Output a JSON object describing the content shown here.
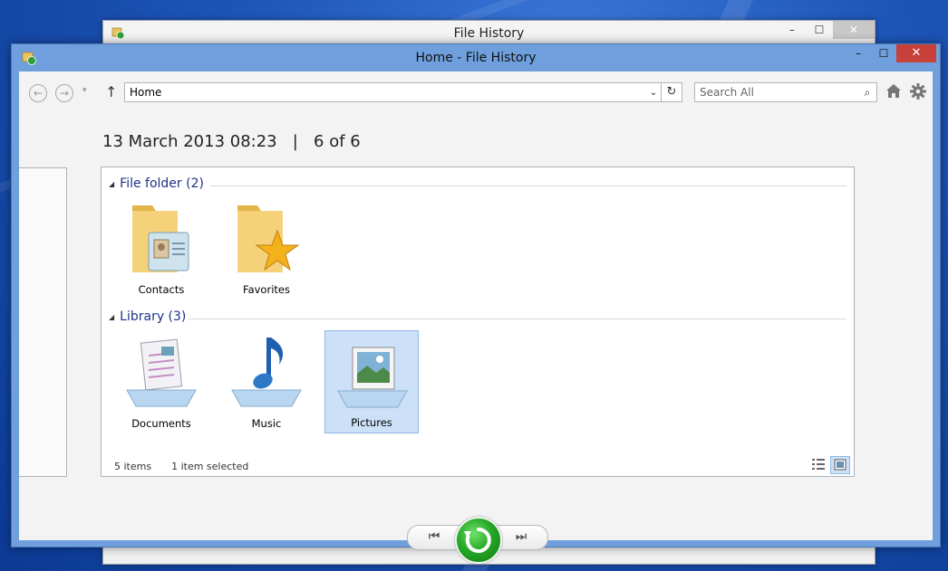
{
  "back_window": {
    "title": "File History",
    "minimize": "–",
    "maximize": "☐",
    "close": "✕"
  },
  "window": {
    "title": "Home - File History",
    "minimize": "–",
    "maximize": "☐",
    "close": "✕"
  },
  "toolbar": {
    "back": "←",
    "forward": "→",
    "dropdown": "▾",
    "up": "↑",
    "address": "Home",
    "address_drop": "⌄",
    "refresh": "↻",
    "search_placeholder": "Search All",
    "search_icon": "⌕"
  },
  "header": {
    "date": "13 March 2013 08:23",
    "separator": "|",
    "position": "6 of 6"
  },
  "groups": [
    {
      "label": "File folder (2)",
      "items": [
        {
          "label": "Contacts",
          "icon": "contacts-folder-icon"
        },
        {
          "label": "Favorites",
          "icon": "favorites-folder-icon"
        }
      ]
    },
    {
      "label": "Library (3)",
      "items": [
        {
          "label": "Documents",
          "icon": "documents-library-icon"
        },
        {
          "label": "Music",
          "icon": "music-library-icon"
        },
        {
          "label": "Pictures",
          "icon": "pictures-library-icon",
          "selected": true
        }
      ]
    }
  ],
  "status": {
    "count": "5 items",
    "selected": "1 item selected"
  },
  "playback": {
    "previous": "⏮",
    "next": "⏭"
  },
  "colors": {
    "title_bar": "#6f9fdc",
    "close_button": "#c7403a",
    "restore_green": "#26a826",
    "group_header": "#1e3287"
  }
}
